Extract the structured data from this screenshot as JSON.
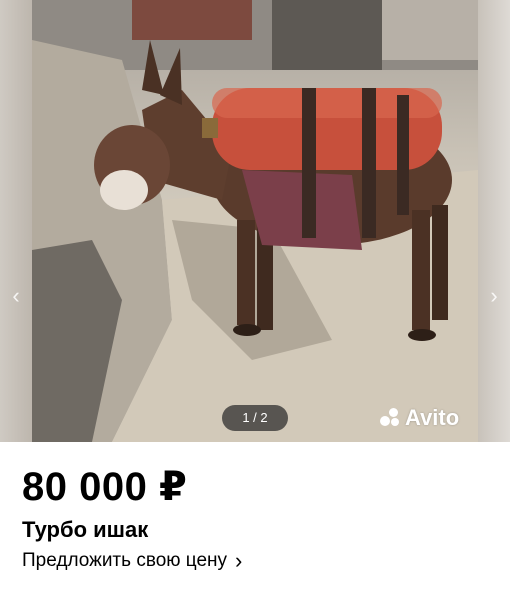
{
  "gallery": {
    "counter": "1 / 2",
    "brand": "Avito",
    "prev_icon": "chevron-left-icon",
    "next_icon": "chevron-right-icon"
  },
  "listing": {
    "price": "80 000 ₽",
    "title": "Турбо ишак",
    "offer_link": "Предложить свою цену",
    "offer_icon": "chevron-right-icon"
  },
  "colors": {
    "price_text": "#000000",
    "background": "#ffffff",
    "counter_bg": "#282828"
  }
}
